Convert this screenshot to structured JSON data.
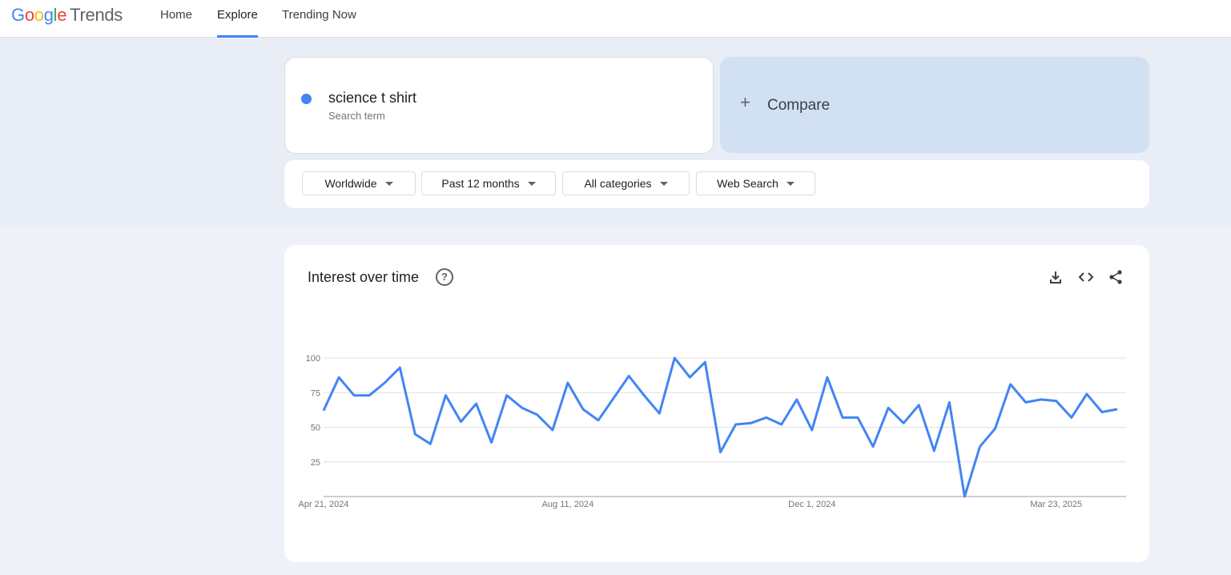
{
  "header": {
    "logo_letters": [
      {
        "char": "G",
        "color": "#4285f4"
      },
      {
        "char": "o",
        "color": "#ea4335"
      },
      {
        "char": "o",
        "color": "#fbbc05"
      },
      {
        "char": "g",
        "color": "#4285f4"
      },
      {
        "char": "l",
        "color": "#34a853"
      },
      {
        "char": "e",
        "color": "#ea4335"
      }
    ],
    "logo_suffix": "Trends",
    "nav": [
      {
        "label": "Home",
        "active": false
      },
      {
        "label": "Explore",
        "active": true
      },
      {
        "label": "Trending Now",
        "active": false
      }
    ]
  },
  "search": {
    "term": "science t shirt",
    "term_sublabel": "Search term",
    "term_color": "#4285f4",
    "compare_label": "Compare",
    "compare_icon": "plus-icon"
  },
  "filters": [
    {
      "label": "Worldwide"
    },
    {
      "label": "Past 12 months"
    },
    {
      "label": "All categories"
    },
    {
      "label": "Web Search"
    }
  ],
  "chart": {
    "title": "Interest over time",
    "help_icon": "help-circle-icon",
    "actions": [
      "download-icon",
      "embed-code-icon",
      "share-icon"
    ]
  },
  "chart_data": {
    "type": "line",
    "line_color": "#4285f4",
    "ylim": [
      0,
      100
    ],
    "y_ticks": [
      25,
      50,
      75,
      100
    ],
    "grid": true,
    "x_tick_labels": [
      {
        "index": 0,
        "label": "Apr 21, 2024"
      },
      {
        "index": 16,
        "label": "Aug 11, 2024"
      },
      {
        "index": 32,
        "label": "Dec 1, 2024"
      },
      {
        "index": 48,
        "label": "Mar 23, 2025"
      }
    ],
    "series": [
      {
        "values": [
          62,
          86,
          73,
          73,
          82,
          93,
          45,
          38,
          73,
          54,
          67,
          39,
          73,
          64,
          59,
          48,
          82,
          63,
          55,
          71,
          87,
          73,
          60,
          100,
          86,
          97,
          32,
          52,
          53,
          57,
          52,
          70,
          48,
          86,
          57,
          57,
          36,
          64,
          53,
          66,
          33,
          68,
          0,
          36,
          49,
          81,
          68,
          70,
          69,
          57,
          74,
          61,
          63
        ]
      }
    ]
  }
}
